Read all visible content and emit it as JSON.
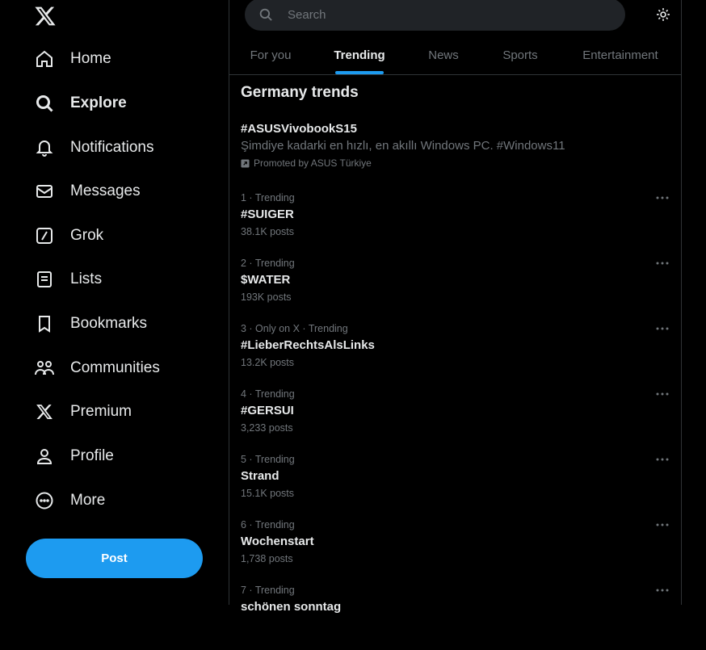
{
  "sidebar": {
    "items": [
      {
        "label": "Home",
        "icon": "home-icon"
      },
      {
        "label": "Explore",
        "icon": "search-icon"
      },
      {
        "label": "Notifications",
        "icon": "bell-icon"
      },
      {
        "label": "Messages",
        "icon": "envelope-icon"
      },
      {
        "label": "Grok",
        "icon": "grok-icon"
      },
      {
        "label": "Lists",
        "icon": "list-icon"
      },
      {
        "label": "Bookmarks",
        "icon": "bookmark-icon"
      },
      {
        "label": "Communities",
        "icon": "communities-icon"
      },
      {
        "label": "Premium",
        "icon": "x-logo-icon"
      },
      {
        "label": "Profile",
        "icon": "person-icon"
      },
      {
        "label": "More",
        "icon": "more-circle-icon"
      }
    ],
    "active": "Explore",
    "post_label": "Post"
  },
  "search": {
    "placeholder": "Search"
  },
  "tabs": [
    "For you",
    "Trending",
    "News",
    "Sports",
    "Entertainment"
  ],
  "active_tab": "Trending",
  "section_title": "Germany trends",
  "promoted": {
    "tag": "#ASUSVivobookS15",
    "description": "Şimdiye kadarki en hızlı, en akıllı Windows PC. #Windows11",
    "promoted_by": "Promoted by ASUS Türkiye"
  },
  "trends": [
    {
      "meta": "1 · Trending",
      "name": "#SUIGER",
      "posts": "38.1K posts"
    },
    {
      "meta": "2 · Trending",
      "name": "$WATER",
      "posts": "193K posts"
    },
    {
      "meta": "3 · Only on X · Trending",
      "name": "#LieberRechtsAlsLinks",
      "posts": "13.2K posts"
    },
    {
      "meta": "4 · Trending",
      "name": "#GERSUI",
      "posts": "3,233 posts"
    },
    {
      "meta": "5 · Trending",
      "name": "Strand",
      "posts": "15.1K posts"
    },
    {
      "meta": "6 · Trending",
      "name": "Wochenstart",
      "posts": "1,738 posts"
    },
    {
      "meta": "7 · Trending",
      "name": "schönen sonntag",
      "posts": ""
    }
  ],
  "colors": {
    "accent": "#1d9bf0",
    "background": "#000000",
    "muted": "#71767b",
    "border": "#2f3336"
  }
}
